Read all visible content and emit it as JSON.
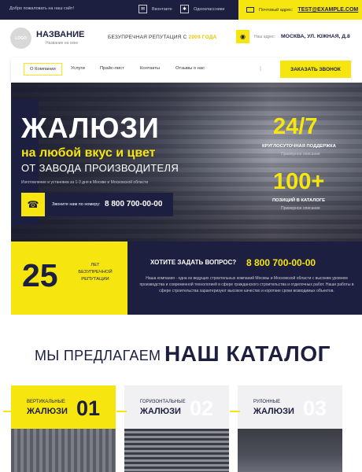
{
  "topbar": {
    "welcome": "Добро пожаловать на наш сайт!",
    "social": [
      {
        "icon": "vk-icon",
        "glyph": "✉",
        "label": "Вконтакте"
      },
      {
        "icon": "ok-icon",
        "glyph": "✱",
        "label": "Одноклассники"
      }
    ],
    "mail_label": "Почтовый адрес:",
    "email": "TEST@EXAMPLE.COM"
  },
  "header": {
    "logo_text": "LOGO",
    "brand": "НАЗВАНИЕ",
    "brand_sub": "Название на окне",
    "reputation_prefix": "БЕЗУПРЕЧНАЯ РЕПУТАЦИЯ С ",
    "reputation_year": "2009 ГОДА",
    "address_label": "Наш адрес:",
    "address": "МОСКВА, УЛ. ЮЖНАЯ, Д.8"
  },
  "nav": {
    "items": [
      "О Компании",
      "Услуги",
      "Прайс-лист",
      "Контакты",
      "Отзывы о нас"
    ],
    "separator": "⁞",
    "call_button": "ЗАКАЗАТЬ ЗВОНОК"
  },
  "hero": {
    "title": "ЖАЛЮЗИ",
    "subtitle1": "на любой вкус и цвет",
    "subtitle2": "ОТ ЗАВОДА ПРОИЗВОДИТЕЛЯ",
    "small": "Изготовление и установка за 1-3 дня в Москве и Московской области",
    "phone_label": "Звоните нам по номеру:",
    "phone": "8 800 700-00-00",
    "stats": [
      {
        "big": "24/7",
        "label": "КРУГЛОСУТОЧНАЯ ПОДДЕРЖКА",
        "sub": "Примерное описание"
      },
      {
        "big": "100+",
        "label": "ПОЗИЦИЙ В КАТАЛОГЕ",
        "sub": "Примерное описание"
      }
    ]
  },
  "band": {
    "years": "25",
    "years_line1": "ЛЕТ",
    "years_line2": "БЕЗУПРЕЧНОЙ",
    "years_line3": "РЕПУТАЦИИ",
    "question": "ХОТИТЕ ЗАДАТЬ ВОПРОС?",
    "phone": "8 800 700-00-00",
    "description": "Наша компания - одна из ведущих строительных компаний Москвы и Московской области с высоким уровнем производства и современной технологией в сфере гражданского строительства и отделочных работ. Наши работы в сфере строительства характеризуют высокое качество и короткие сроки возводимых объектов."
  },
  "catalog": {
    "heading1": "МЫ ПРЕДЛАГАЕМ",
    "heading2": "НАШ КАТАЛОГ",
    "cards": [
      {
        "line1": "ВЕРТИКАЛЬНЫЕ",
        "line2": "ЖАЛЮЗИ",
        "number": "01"
      },
      {
        "line1": "ГОРИЗОНТАЛЬНЫЕ",
        "line2": "ЖАЛЮЗИ",
        "number": "02"
      },
      {
        "line1": "РУЛОННЫЕ",
        "line2": "ЖАЛЮЗИ",
        "number": "03"
      }
    ]
  },
  "colors": {
    "accent": "#f6e50e",
    "dark": "#1c1f3f"
  }
}
